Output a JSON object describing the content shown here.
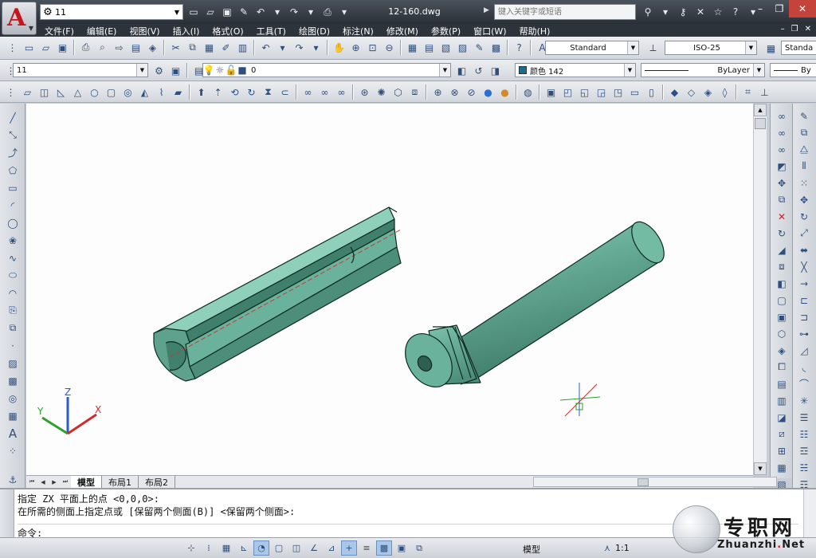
{
  "titlebar": {
    "workspace": "11",
    "doc_title": "12-160.dwg",
    "search_placeholder": "键入关键字或短语"
  },
  "menu": [
    "文件(F)",
    "编辑(E)",
    "视图(V)",
    "插入(I)",
    "格式(O)",
    "工具(T)",
    "绘图(D)",
    "标注(N)",
    "修改(M)",
    "参数(P)",
    "窗口(W)",
    "帮助(H)"
  ],
  "toolbar": {
    "text_style": "Standard",
    "dim_style": "ISO-25",
    "table_style": "Standa",
    "layer_combo": "11",
    "layer_current": "0",
    "color": "颜色 142",
    "color_hex": "#1d6c8c",
    "linetype": "ByLayer",
    "lineweight": "By"
  },
  "tabs": [
    "模型",
    "布局1",
    "布局2"
  ],
  "command": {
    "line1": "指定 ZX 平面上的点 <0,0,0>:",
    "line2": "在所需的侧面上指定点或 [保留两个侧面(B)] <保留两个侧面>:",
    "prompt": "命令:"
  },
  "status": {
    "model": "模型",
    "scale": "1:1"
  },
  "ucs": {
    "x_label": "X",
    "y_label": "Y",
    "z_label": "Z"
  },
  "watermark": {
    "cn": "专职网",
    "en_part1": "Zhuanzhi",
    "en_dot": ".",
    "en_part2": "Net"
  },
  "colors": {
    "solid_face": "#5fa38e",
    "solid_top": "#7cc2ab",
    "solid_dark": "#3e7a68"
  }
}
